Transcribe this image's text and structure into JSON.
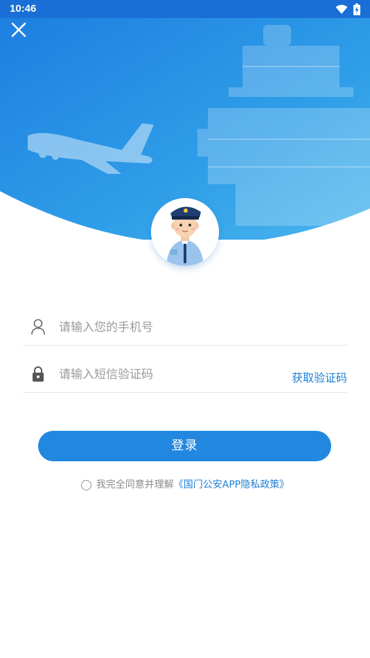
{
  "status_bar": {
    "time": "10:46",
    "icons": [
      "wifi-icon",
      "battery-charging-icon"
    ]
  },
  "header": {
    "close_icon": "close-icon",
    "illustration": "airport control tower and airplane",
    "brand_color": "#2288df"
  },
  "form": {
    "phone": {
      "icon": "person-icon",
      "placeholder": "请输入您的手机号",
      "value": ""
    },
    "sms_code": {
      "icon": "lock-icon",
      "placeholder": "请输入短信验证码",
      "value": "",
      "get_code_label": "获取验证码"
    },
    "login_label": "登录"
  },
  "agreement": {
    "checked": false,
    "text": "我完全同意并理解",
    "link_text": "《国门公安APP隐私政策》"
  }
}
